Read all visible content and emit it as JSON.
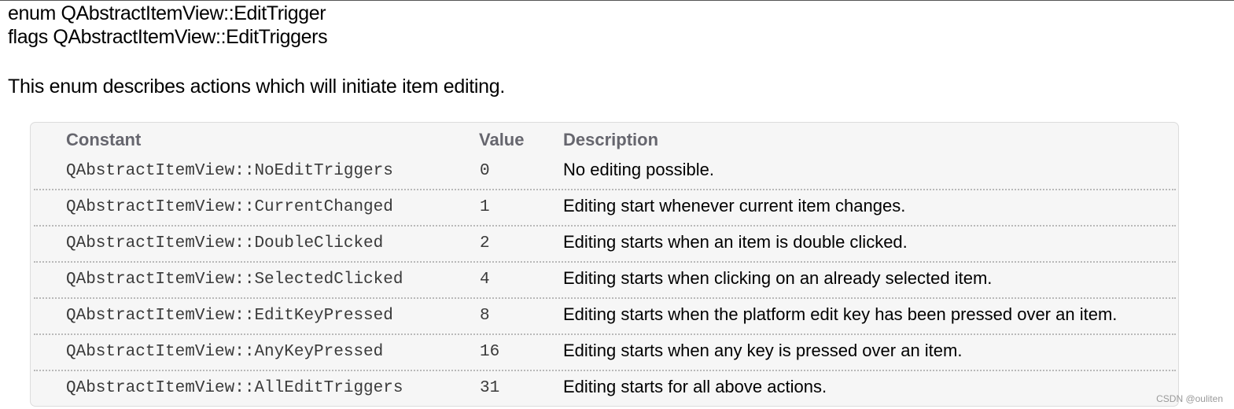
{
  "signature": {
    "line1": "enum QAbstractItemView::EditTrigger",
    "line2": "flags QAbstractItemView::EditTriggers"
  },
  "intro": "This enum describes actions which will initiate item editing.",
  "table": {
    "headers": {
      "constant": "Constant",
      "value": "Value",
      "description": "Description"
    },
    "rows": [
      {
        "constant": "QAbstractItemView::NoEditTriggers",
        "value": "0",
        "description": "No editing possible."
      },
      {
        "constant": "QAbstractItemView::CurrentChanged",
        "value": "1",
        "description": "Editing start whenever current item changes."
      },
      {
        "constant": "QAbstractItemView::DoubleClicked",
        "value": "2",
        "description": "Editing starts when an item is double clicked."
      },
      {
        "constant": "QAbstractItemView::SelectedClicked",
        "value": "4",
        "description": "Editing starts when clicking on an already selected item."
      },
      {
        "constant": "QAbstractItemView::EditKeyPressed",
        "value": "8",
        "description": "Editing starts when the platform edit key has been pressed over an item."
      },
      {
        "constant": "QAbstractItemView::AnyKeyPressed",
        "value": "16",
        "description": "Editing starts when any key is pressed over an item."
      },
      {
        "constant": "QAbstractItemView::AllEditTriggers",
        "value": "31",
        "description": "Editing starts for all above actions."
      }
    ]
  },
  "watermark": "CSDN @ouliten"
}
